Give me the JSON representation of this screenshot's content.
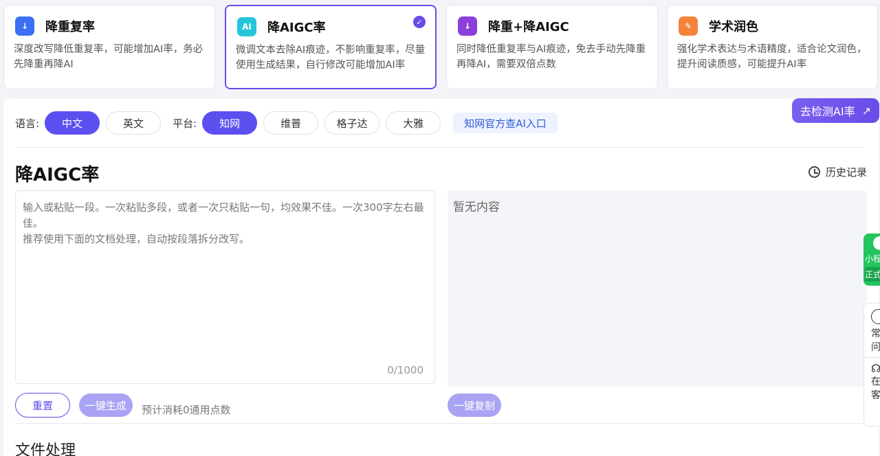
{
  "cards": [
    {
      "title": "降重复率",
      "desc": "深度改写降低重复率，可能增加AI率，务必先降重再降AI",
      "icon": "document-down-icon",
      "color": "#3b6ff5"
    },
    {
      "title": "降AIGC率",
      "desc": "微调文本去除AI痕迹，不影响重复率，尽量使用生成结果，自行修改可能增加AI率",
      "icon": "ai-document-icon",
      "color": "#26c6da",
      "selected": true
    },
    {
      "title": "降重+降AIGC",
      "desc": "同时降低重复率与AI痕迹，免去手动先降重再降AI，需要双倍点数",
      "icon": "combined-document-icon",
      "color": "#8b3fd9"
    },
    {
      "title": "学术润色",
      "desc": "强化学术表达与术语精度，适合论文润色，提升阅读质感，可能提升AI率",
      "icon": "polish-pen-icon",
      "color": "#f5823b"
    }
  ],
  "filters": {
    "language_label": "语言:",
    "languages": [
      "中文",
      "英文"
    ],
    "platform_label": "平台:",
    "platforms": [
      "知网",
      "维普",
      "格子达",
      "大雅"
    ],
    "official_link": "知网官方查AI入口"
  },
  "detect_button": "去检测AI率",
  "page_title": "降AIGC率",
  "history_label": "历史记录",
  "input": {
    "placeholder_line1": "输入或粘贴一段。一次粘贴多段，或者一次只粘贴一句，均效果不佳。一次300字左右最佳。",
    "placeholder_line2": "推荐使用下面的文档处理，自动按段落拆分改写。",
    "counter": "0/1000"
  },
  "output": {
    "empty_text": "暂无内容"
  },
  "actions": {
    "reset": "重置",
    "generate": "一键生成",
    "cost": "预计消耗0通用点数",
    "copy": "一键复制"
  },
  "section_title": "文件处理",
  "side": {
    "mini_label": "小程",
    "mini_tag": "正式",
    "faq": "常问",
    "service": "在客"
  }
}
